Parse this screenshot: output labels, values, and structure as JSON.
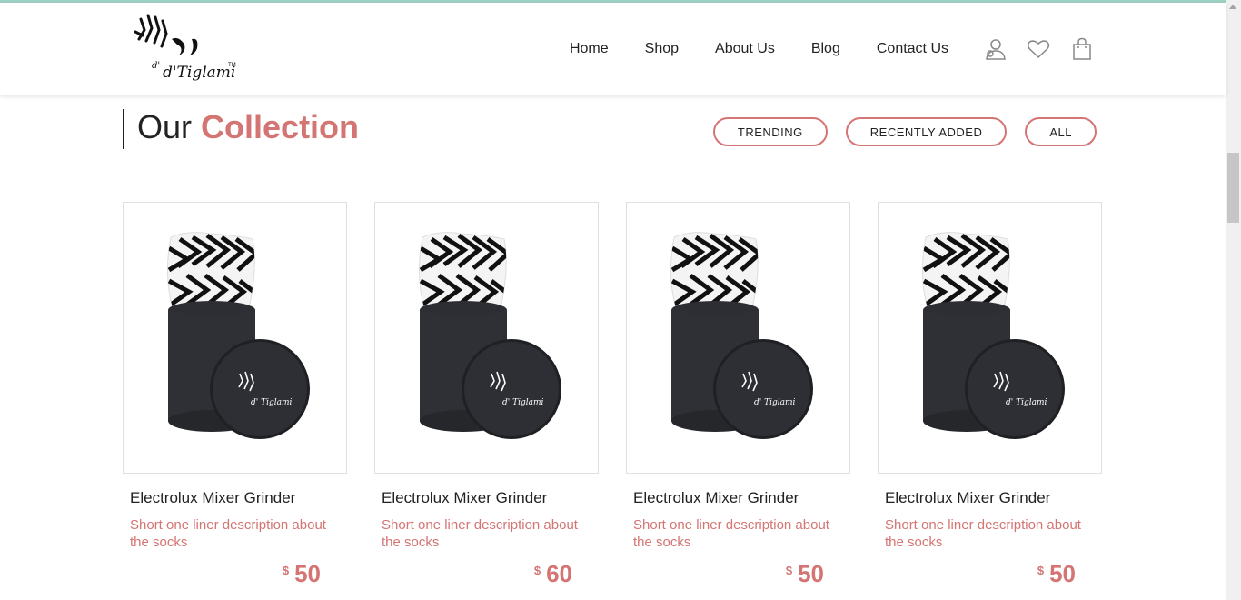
{
  "header": {
    "logo_text": "d'Tiglami",
    "nav": [
      {
        "label": "Home",
        "name": "nav-home"
      },
      {
        "label": "Shop",
        "name": "nav-shop"
      },
      {
        "label": "About Us",
        "name": "nav-about-us"
      },
      {
        "label": "Blog",
        "name": "nav-blog"
      },
      {
        "label": "Contact Us",
        "name": "nav-contact-us"
      }
    ],
    "icons": [
      "user-icon",
      "heart-icon",
      "shopping-bag-icon"
    ]
  },
  "section": {
    "title_plain": "Our",
    "title_accent": "Collection"
  },
  "filters": {
    "trending": "TRENDING",
    "recently_added": "RECENTLY ADDED",
    "all": "ALL"
  },
  "products": [
    {
      "name": "Electrolux Mixer Grinder",
      "description": "Short one liner description about the socks",
      "currency": "$",
      "price": "50"
    },
    {
      "name": "Electrolux Mixer Grinder",
      "description": "Short one liner description about the socks",
      "currency": "$",
      "price": "60"
    },
    {
      "name": "Electrolux Mixer Grinder",
      "description": "Short one liner description about the socks",
      "currency": "$",
      "price": "50"
    },
    {
      "name": "Electrolux Mixer Grinder",
      "description": "Short one liner description about the socks",
      "currency": "$",
      "price": "50"
    }
  ],
  "colors": {
    "accent": "#d47574",
    "text": "#222222",
    "top_line": "#9fd0c4"
  }
}
